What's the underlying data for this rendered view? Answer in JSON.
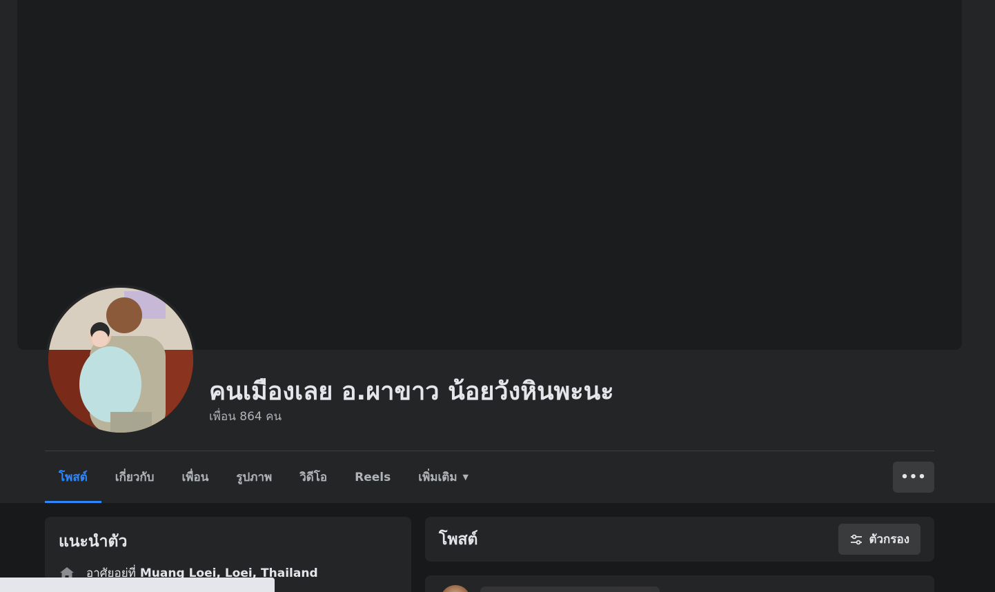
{
  "profile": {
    "name": "คนเมืองเลย อ.ผาขาว น้อยวังหินพะนะ",
    "friends": "เพื่อน 864 คน"
  },
  "tabs": [
    {
      "label": "โพสต์",
      "active": true
    },
    {
      "label": "เกี่ยวกับ",
      "active": false
    },
    {
      "label": "เพื่อน",
      "active": false
    },
    {
      "label": "รูปภาพ",
      "active": false
    },
    {
      "label": "วิดีโอ",
      "active": false
    },
    {
      "label": "Reels",
      "active": false
    },
    {
      "label": "เพิ่มเติม",
      "active": false
    }
  ],
  "more_button": {
    "label": "•••"
  },
  "intro": {
    "title": "แนะนำตัว",
    "lives_prefix": "อาศัยอยู่ที่",
    "lives_place": "Muang Loei, Loei, Thailand"
  },
  "posts": {
    "title": "โพสต์",
    "filter_label": "ตัวกรอง"
  },
  "icons": {
    "home": "home-icon",
    "filter": "filter-icon",
    "more": "more-dots-icon",
    "caret": "caret-down-icon"
  },
  "colors": {
    "accent": "#2d88ff",
    "background": "#18191a",
    "card": "#242526",
    "button": "#3a3b3c",
    "text": "#e4e6eb",
    "secondary_text": "#b0b3b8"
  }
}
